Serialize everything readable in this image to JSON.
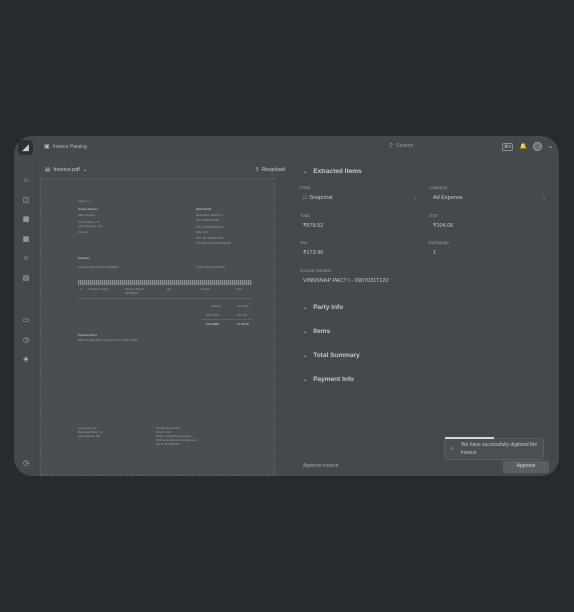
{
  "app": {
    "logo": "◢",
    "breadcrumb": "Invoice Parsing"
  },
  "search": {
    "placeholder": "Search"
  },
  "topbar": {
    "shortcut_mod": "⌘K",
    "shortcut_key": "K",
    "bell": "♪",
    "chevron": "⌄"
  },
  "sidebar": {
    "icons": [
      "home-icon",
      "bag-icon",
      "gift-icon",
      "calendar-icon",
      "users-icon",
      "archive-icon",
      "stack-icon",
      "chart-icon",
      "tag-icon",
      "help-icon"
    ]
  },
  "document": {
    "filename": "Invoice.pdf",
    "reupload": "Reupload",
    "lines": {
      "page": "Page 1 / 1",
      "bill_from": "Invoice Address",
      "bill_from_l1": "ABC Company",
      "bill_from_l2": "Street Address, 14",
      "bill_from_l3": "Delhi Gurugram, 123",
      "bill_from_l4": "India, 1A",
      "ship_to": "Bank Details",
      "ship_to_l1": "Bank Name: Mellon Co.",
      "ship_to_l2": "IFSC: SBIN0011AB",
      "ship_to_l3": "ACC: 01234567891234",
      "ship_to_l4": "Tally: 0123",
      "ship_to_l5": "PAN: AB: ABCDE1234F",
      "ship_to_l6": "GST: AB: 22AAAAA0000A1Z5",
      "summary": "Summary",
      "summary_sub": "Snapchat Ads: Paid on 10/10/2023",
      "summary_right": "Invoice Date: 10/10/2023",
      "col1": "#",
      "col2": "Product / Service",
      "col3": "Amount / Period",
      "col4": "Qty",
      "col5": "Amount",
      "col6": "Total",
      "row1a": "1",
      "row1b": "Snapchat Ads",
      "row1c": "₹1,578.52",
      "row1d": "01/10/2023",
      "sub_label": "Subtotal",
      "sub_val": "₹1,578.52",
      "gst_label": "GST (18%)",
      "gst_val": "₹171.96",
      "total_label": "Total (INR)",
      "total_val": "₹1,750.48",
      "pay_title": "Payment Terms",
      "pay_text": "Within 30 days after receipt of invoice. Bank transfer.",
      "foot_l1": "Snap Group Ltd",
      "foot_l2": "Registered Office: 14",
      "foot_l3": "India, Mumbai, 400",
      "foot_r1": "Contact: Snap Group",
      "foot_r2": "Phone: 0123",
      "foot_r3": "Email: contact@snap.example",
      "foot_r4": "Web: www.snapchat.com/business",
      "foot_r5": "Tax ID: 0123456789"
    }
  },
  "extracted": {
    "title": "Extracted Items",
    "fields": {
      "party_label": "Party",
      "party_value": "Snapchat",
      "category_label": "Category",
      "category_value": "Ad Expense",
      "total_label": "Total",
      "total_value": "₹578.52",
      "gst_label": "GST",
      "gst_value": "₹104.06",
      "tax_label": "Tax",
      "tax_value": "₹173.96",
      "exchange_label": "Exchange",
      "exchange_value": "1",
      "invoice_label": "Invoice Number",
      "invoice_value": "VINNSNAP PACT I - 0907031T122"
    }
  },
  "sections": [
    {
      "label": "Party Info"
    },
    {
      "label": "Items"
    },
    {
      "label": "Total Summary"
    },
    {
      "label": "Payment Info"
    }
  ],
  "footer": {
    "approve_link": "Approve invoice",
    "approve_button": "Approve"
  },
  "toast": {
    "text": "We have successfully digitised the invoice",
    "icon": "✓"
  }
}
